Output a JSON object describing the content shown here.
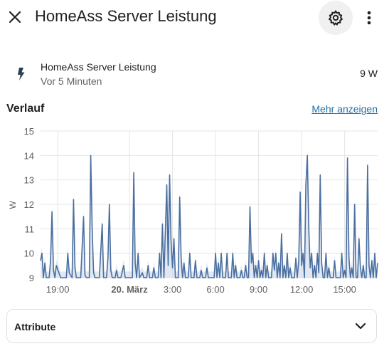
{
  "header": {
    "title": "HomeAss Server Leistung",
    "close_icon": "close-icon",
    "settings_icon": "gear-icon",
    "menu_icon": "more-vertical-icon"
  },
  "entity": {
    "icon": "lightning-bolt-icon",
    "name": "HomeAss Server Leistung",
    "last_changed": "Vor 5 Minuten",
    "state": "9 W"
  },
  "history": {
    "title": "Verlauf",
    "more_link": "Mehr anzeigen"
  },
  "chart_data": {
    "type": "line",
    "ylabel": "W",
    "ylim": [
      9,
      15
    ],
    "yticks": [
      "15",
      "14",
      "13",
      "12",
      "11",
      "10",
      "9"
    ],
    "xticks": [
      "19:00",
      "20. März",
      "3:00",
      "6:00",
      "9:00",
      "12:00",
      "15:00"
    ],
    "xlim_hours": [
      17.8,
      41.3
    ],
    "xtick_hours": [
      19,
      24,
      27,
      30,
      33,
      36,
      39
    ],
    "colors": {
      "line": "#4a6fa0",
      "band": "#c9d6e6",
      "grid": "#e4e4e4"
    },
    "series": [
      {
        "values": [
          [
            17.8,
            9.7
          ],
          [
            17.9,
            10.0
          ],
          [
            18.0,
            9.0
          ],
          [
            18.1,
            9.6
          ],
          [
            18.2,
            9.0
          ],
          [
            18.4,
            9.0
          ],
          [
            18.5,
            9.7
          ],
          [
            18.6,
            11.7
          ],
          [
            18.7,
            9.3
          ],
          [
            18.8,
            9.0
          ],
          [
            18.9,
            9.5
          ],
          [
            19.2,
            9.0
          ],
          [
            19.6,
            9.0
          ],
          [
            19.7,
            10.0
          ],
          [
            19.8,
            9.2
          ],
          [
            20.0,
            9.0
          ],
          [
            20.1,
            12.2
          ],
          [
            20.2,
            9.4
          ],
          [
            20.3,
            9.0
          ],
          [
            20.6,
            9.0
          ],
          [
            20.8,
            11.5
          ],
          [
            20.9,
            9.1
          ],
          [
            21.0,
            9.0
          ],
          [
            21.2,
            9.0
          ],
          [
            21.3,
            14.0
          ],
          [
            21.4,
            11.0
          ],
          [
            21.5,
            9.2
          ],
          [
            21.6,
            9.0
          ],
          [
            21.9,
            9.0
          ],
          [
            22.1,
            11.2
          ],
          [
            22.2,
            9.0
          ],
          [
            22.4,
            9.0
          ],
          [
            22.5,
            9.8
          ],
          [
            22.6,
            12.0
          ],
          [
            22.7,
            9.3
          ],
          [
            22.8,
            9.0
          ],
          [
            23.0,
            9.0
          ],
          [
            23.1,
            9.3
          ],
          [
            23.2,
            9.0
          ],
          [
            23.4,
            9.0
          ],
          [
            23.6,
            9.5
          ],
          [
            23.7,
            9.0
          ],
          [
            24.0,
            9.0
          ],
          [
            24.2,
            9.0
          ],
          [
            24.3,
            13.3
          ],
          [
            24.4,
            9.6
          ],
          [
            24.5,
            9.0
          ],
          [
            24.6,
            10.0
          ],
          [
            24.7,
            9.0
          ],
          [
            24.9,
            9.2
          ],
          [
            25.0,
            9.0
          ],
          [
            25.2,
            9.0
          ],
          [
            25.3,
            9.5
          ],
          [
            25.4,
            9.0
          ],
          [
            25.6,
            9.0
          ],
          [
            25.7,
            9.4
          ],
          [
            25.8,
            9.0
          ],
          [
            26.0,
            9.0
          ],
          [
            26.1,
            10.0
          ],
          [
            26.2,
            9.0
          ],
          [
            26.3,
            11.2
          ],
          [
            26.4,
            9.0
          ],
          [
            26.6,
            12.8
          ],
          [
            26.7,
            9.5
          ],
          [
            26.8,
            13.2
          ],
          [
            26.9,
            10.5
          ],
          [
            27.0,
            9.4
          ],
          [
            27.1,
            10.6
          ],
          [
            27.2,
            9.0
          ],
          [
            27.4,
            9.0
          ],
          [
            27.5,
            12.3
          ],
          [
            27.6,
            9.8
          ],
          [
            27.7,
            9.0
          ],
          [
            27.8,
            9.6
          ],
          [
            27.9,
            9.0
          ],
          [
            28.1,
            9.0
          ],
          [
            28.2,
            10.0
          ],
          [
            28.3,
            9.0
          ],
          [
            28.5,
            9.0
          ],
          [
            28.6,
            9.7
          ],
          [
            28.7,
            9.0
          ],
          [
            28.9,
            9.0
          ],
          [
            29.0,
            9.3
          ],
          [
            29.1,
            9.0
          ],
          [
            29.3,
            9.0
          ],
          [
            29.4,
            9.4
          ],
          [
            29.5,
            9.0
          ],
          [
            29.7,
            9.0
          ],
          [
            29.8,
            9.0
          ],
          [
            29.9,
            9.0
          ],
          [
            30.0,
            10.0
          ],
          [
            30.1,
            9.0
          ],
          [
            30.2,
            9.6
          ],
          [
            30.3,
            9.0
          ],
          [
            30.4,
            10.0
          ],
          [
            30.5,
            9.0
          ],
          [
            30.7,
            9.0
          ],
          [
            30.8,
            10.0
          ],
          [
            30.9,
            9.0
          ],
          [
            31.0,
            9.0
          ],
          [
            31.1,
            9.0
          ],
          [
            31.2,
            10.0
          ],
          [
            31.3,
            9.0
          ],
          [
            31.4,
            9.5
          ],
          [
            31.5,
            9.0
          ],
          [
            31.7,
            9.0
          ],
          [
            31.8,
            9.3
          ],
          [
            31.9,
            9.0
          ],
          [
            32.0,
            9.0
          ],
          [
            32.1,
            9.5
          ],
          [
            32.2,
            9.0
          ],
          [
            32.3,
            9.0
          ],
          [
            32.4,
            11.9
          ],
          [
            32.5,
            9.6
          ],
          [
            32.6,
            10.0
          ],
          [
            32.7,
            9.0
          ],
          [
            32.8,
            9.5
          ],
          [
            32.9,
            9.0
          ],
          [
            33.0,
            9.7
          ],
          [
            33.1,
            9.0
          ],
          [
            33.2,
            9.3
          ],
          [
            33.3,
            9.0
          ],
          [
            33.4,
            10.0
          ],
          [
            33.5,
            9.0
          ],
          [
            33.6,
            9.5
          ],
          [
            33.7,
            9.0
          ],
          [
            33.8,
            9.0
          ],
          [
            33.9,
            9.0
          ],
          [
            34.0,
            10.0
          ],
          [
            34.1,
            9.3
          ],
          [
            34.2,
            10.0
          ],
          [
            34.3,
            9.0
          ],
          [
            34.4,
            9.6
          ],
          [
            34.5,
            9.0
          ],
          [
            34.6,
            10.8
          ],
          [
            34.7,
            9.0
          ],
          [
            34.8,
            9.5
          ],
          [
            34.9,
            9.0
          ],
          [
            35.0,
            10.0
          ],
          [
            35.1,
            9.0
          ],
          [
            35.2,
            9.4
          ],
          [
            35.3,
            9.0
          ],
          [
            35.4,
            9.0
          ],
          [
            35.5,
            9.0
          ],
          [
            35.6,
            9.8
          ],
          [
            35.7,
            9.0
          ],
          [
            35.8,
            9.7
          ],
          [
            35.9,
            12.5
          ],
          [
            36.0,
            9.5
          ],
          [
            36.1,
            10.0
          ],
          [
            36.2,
            9.0
          ],
          [
            36.3,
            12.8
          ],
          [
            36.4,
            14.0
          ],
          [
            36.5,
            11.0
          ],
          [
            36.6,
            9.4
          ],
          [
            36.7,
            10.0
          ],
          [
            36.8,
            9.0
          ],
          [
            36.9,
            9.5
          ],
          [
            37.0,
            9.0
          ],
          [
            37.1,
            10.0
          ],
          [
            37.2,
            9.2
          ],
          [
            37.3,
            13.2
          ],
          [
            37.4,
            9.6
          ],
          [
            37.5,
            9.0
          ],
          [
            37.6,
            9.0
          ],
          [
            37.7,
            10.0
          ],
          [
            37.8,
            9.0
          ],
          [
            37.9,
            9.4
          ],
          [
            38.0,
            9.0
          ],
          [
            38.1,
            9.0
          ],
          [
            38.2,
            9.0
          ],
          [
            38.3,
            9.7
          ],
          [
            38.4,
            9.0
          ],
          [
            38.5,
            9.0
          ],
          [
            38.7,
            9.0
          ],
          [
            38.8,
            10.0
          ],
          [
            38.9,
            9.0
          ],
          [
            39.0,
            9.3
          ],
          [
            39.1,
            9.0
          ],
          [
            39.2,
            13.9
          ],
          [
            39.3,
            9.8
          ],
          [
            39.4,
            9.0
          ],
          [
            39.5,
            9.4
          ],
          [
            39.6,
            9.0
          ],
          [
            39.7,
            12.0
          ],
          [
            39.8,
            9.0
          ],
          [
            39.9,
            9.0
          ],
          [
            40.0,
            10.6
          ],
          [
            40.1,
            9.4
          ],
          [
            40.2,
            9.0
          ],
          [
            40.3,
            9.5
          ],
          [
            40.4,
            9.0
          ],
          [
            40.5,
            9.0
          ],
          [
            40.6,
            13.6
          ],
          [
            40.7,
            9.5
          ],
          [
            40.8,
            9.0
          ],
          [
            40.9,
            9.7
          ],
          [
            41.0,
            9.0
          ],
          [
            41.1,
            10.0
          ],
          [
            41.2,
            9.0
          ],
          [
            41.3,
            9.6
          ]
        ]
      }
    ]
  },
  "attributes": {
    "label": "Attribute",
    "chevron_icon": "chevron-down-icon"
  }
}
